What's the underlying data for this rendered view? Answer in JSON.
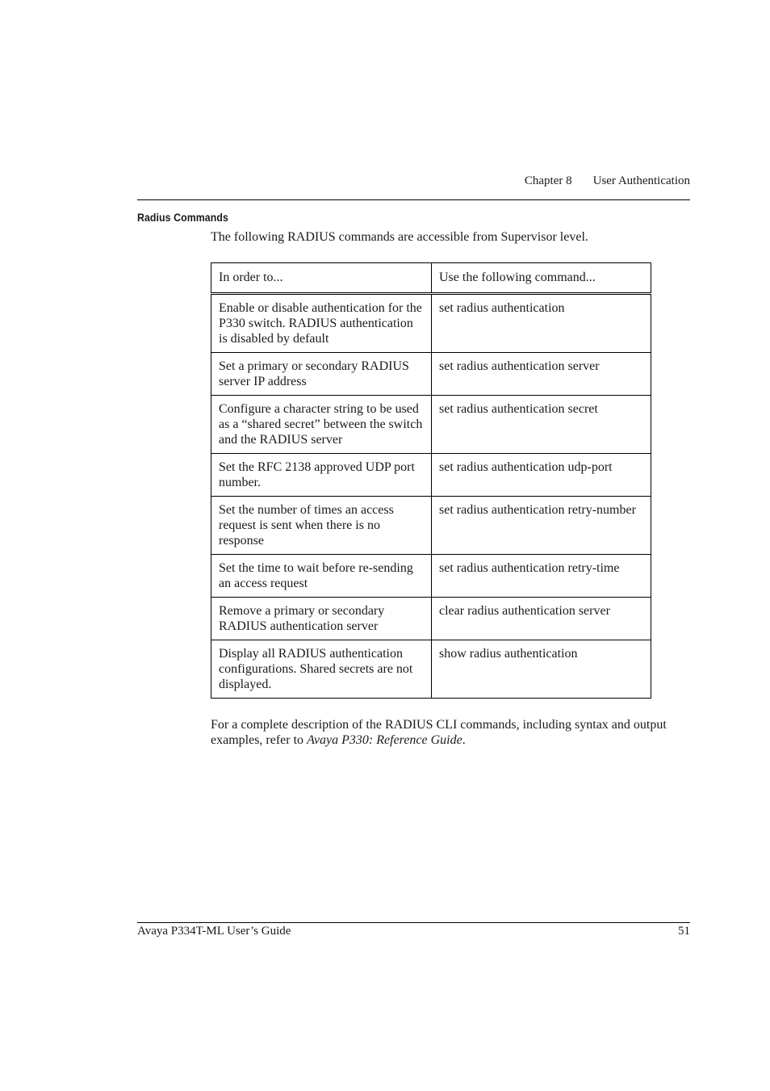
{
  "header": {
    "chapter": "Chapter 8",
    "chapter_title": "User Authentication"
  },
  "section": {
    "heading": "Radius Commands",
    "intro": "The following RADIUS commands are accessible from Supervisor level."
  },
  "table": {
    "columns": [
      "In order to...",
      "Use the following command..."
    ],
    "rows": [
      {
        "purpose": "Enable or disable authentication for the P330 switch. RADIUS authentication is disabled by default",
        "command": "set radius authentication"
      },
      {
        "purpose": "Set a primary or secondary RADIUS server IP address",
        "command": "set radius authentication server"
      },
      {
        "purpose": "Configure a character string to be used as a “shared secret” between the switch and the RADIUS server",
        "command": "set radius authentication secret"
      },
      {
        "purpose": "Set the RFC 2138 approved UDP port number.",
        "command": "set radius authentication udp-port"
      },
      {
        "purpose": "Set the number of times an access request is sent when there is no response",
        "command": "set radius authentication retry-number"
      },
      {
        "purpose": "Set the time to wait before re-sending an access request",
        "command": "set radius authentication retry-time"
      },
      {
        "purpose": "Remove a primary or secondary RADIUS authentication server",
        "command": "clear radius authentication server"
      },
      {
        "purpose": "Display all RADIUS authentication configurations. Shared secrets are not displayed.",
        "command": "show radius authentication"
      }
    ]
  },
  "closing": {
    "text_before": "For a complete description of the RADIUS CLI commands, including syntax and output examples, refer to ",
    "reference": "Avaya P330: Reference Guide",
    "text_after": "."
  },
  "footer": {
    "guide_title": "Avaya P334T-ML User’s Guide",
    "page_number": "51"
  }
}
